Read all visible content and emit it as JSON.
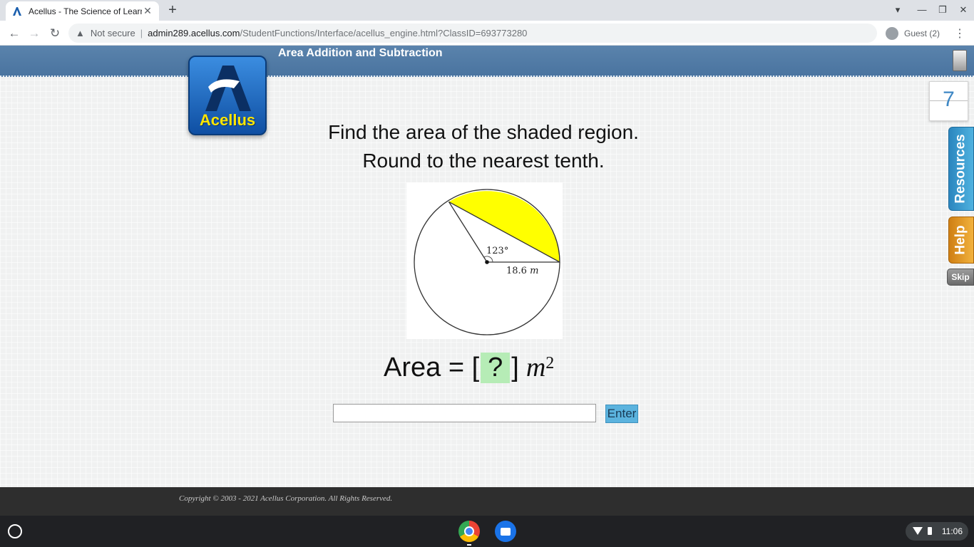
{
  "browser": {
    "tab_title": "Acellus - The Science of Learning",
    "tab_close_glyph": "✕",
    "new_tab_glyph": "+",
    "url_warning": "Not secure",
    "url_separator": "|",
    "url_host": "admin289.acellus.com",
    "url_path": "/StudentFunctions/Interface/acellus_engine.html?ClassID=693773280",
    "profile_label": "Guest (2)",
    "back_glyph": "←",
    "forward_glyph": "→",
    "reload_glyph": "↻",
    "menu_glyph": "⋮",
    "minimize_glyph": "—",
    "restore_glyph": "❐",
    "close_glyph": "✕",
    "tab_search_glyph": "▾",
    "warning_glyph": "▲"
  },
  "lesson": {
    "title": "Area Addition and Subtraction",
    "logo_text": "Acellus",
    "question_line1": "Find the area of the shaded region.",
    "question_line2": "Round to the nearest tenth.",
    "figure": {
      "angle_label": "123°",
      "radius_value": "18.6",
      "radius_unit": "m",
      "shade_color": "#ffff00"
    },
    "area_prefix": "Area = [",
    "area_placeholder": "?",
    "area_suffix": "]",
    "area_unit": "m",
    "area_exponent": "2",
    "answer_value": "",
    "enter_label": "Enter",
    "problem_counter": "7",
    "resources_label": "Resources",
    "help_label": "Help",
    "skip_label": "Skip",
    "copyright": "Copyright © 2003 - 2021 Acellus Corporation.  All Rights Reserved."
  },
  "shelf": {
    "time": "11:06"
  },
  "colors": {
    "banner": "#4a74a0",
    "enter_button": "#5bb3de",
    "answer_box_highlight": "#b6ecb6",
    "resources_tab": "#3a9fd3",
    "help_tab": "#e39a26"
  }
}
